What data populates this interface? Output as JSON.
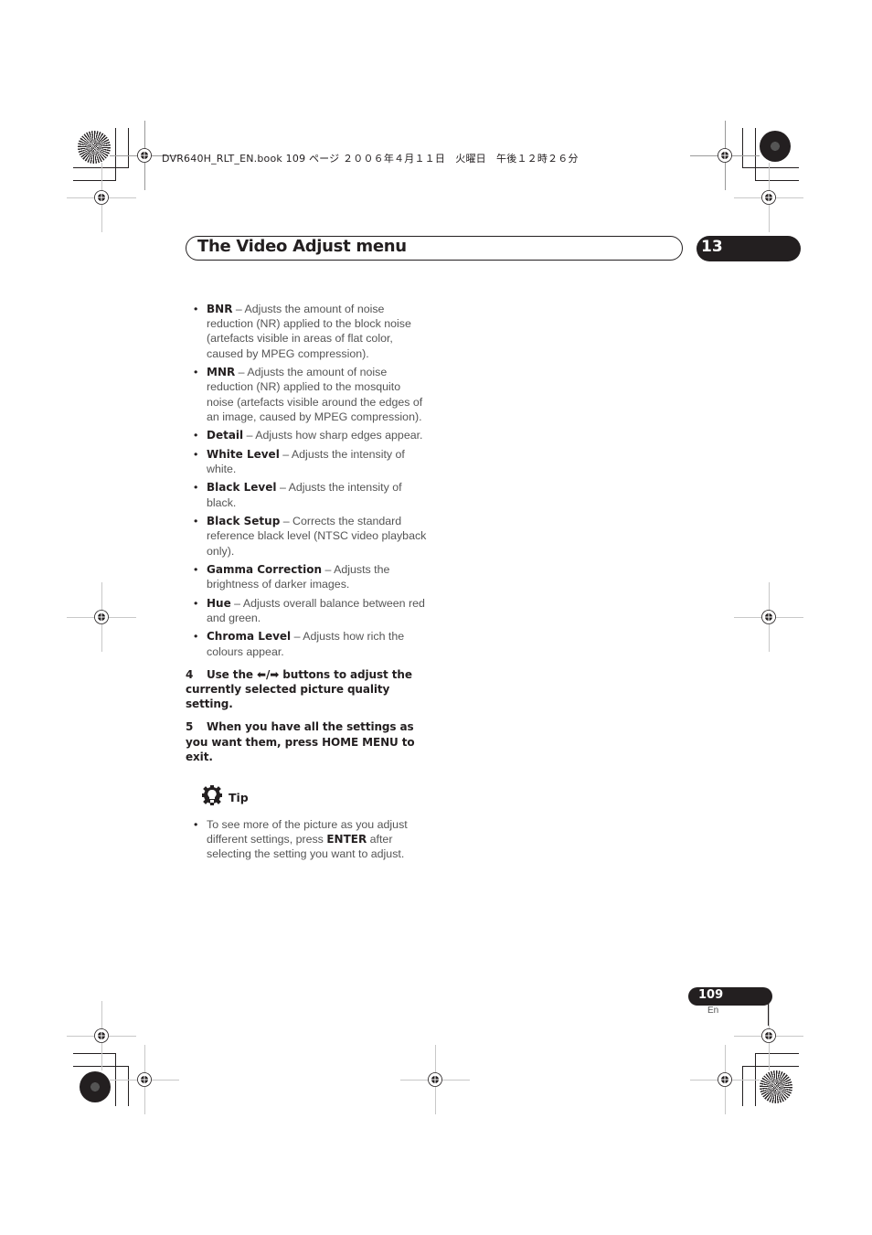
{
  "book_info": "DVR640H_RLT_EN.book  109 ページ  ２００６年４月１１日　火曜日　午後１２時２６分",
  "header": {
    "title": "The Video Adjust menu",
    "chapter_number": "13"
  },
  "settings_list": [
    {
      "name": "BNR",
      "description": " – Adjusts the amount of noise reduction (NR) applied to the block noise (artefacts visible in areas of flat color, caused by MPEG compression)."
    },
    {
      "name": "MNR",
      "description": " – Adjusts the amount of noise reduction (NR) applied to the mosquito noise (artefacts visible around the edges of an image, caused by MPEG compression)."
    },
    {
      "name": "Detail",
      "description": " – Adjusts how sharp edges appear."
    },
    {
      "name": "White Level",
      "description": " – Adjusts the intensity of white."
    },
    {
      "name": "Black Level",
      "description": " – Adjusts the intensity of black."
    },
    {
      "name": "Black Setup",
      "description": " – Corrects the standard reference black level (NTSC video playback only)."
    },
    {
      "name": "Gamma Correction",
      "description": " – Adjusts the brightness of darker images."
    },
    {
      "name": "Hue",
      "description": " – Adjusts overall balance between red and green."
    },
    {
      "name": "Chroma Level",
      "description": " – Adjusts how rich the colours appear."
    }
  ],
  "steps": [
    {
      "number": "4",
      "text": "Use the ⬅/➡ buttons to adjust the currently selected picture quality setting."
    },
    {
      "number": "5",
      "text": "When you have all the settings as you want them, press HOME MENU to exit."
    }
  ],
  "tip": {
    "icon": "lightbulb-gear-icon",
    "label": "Tip",
    "text_before": "To see more of the picture as you adjust different settings, press ",
    "bold": "ENTER",
    "text_after": " after selecting the setting you want to adjust."
  },
  "footer": {
    "page_number": "109",
    "language": "En"
  },
  "bullet_glyph": "•"
}
